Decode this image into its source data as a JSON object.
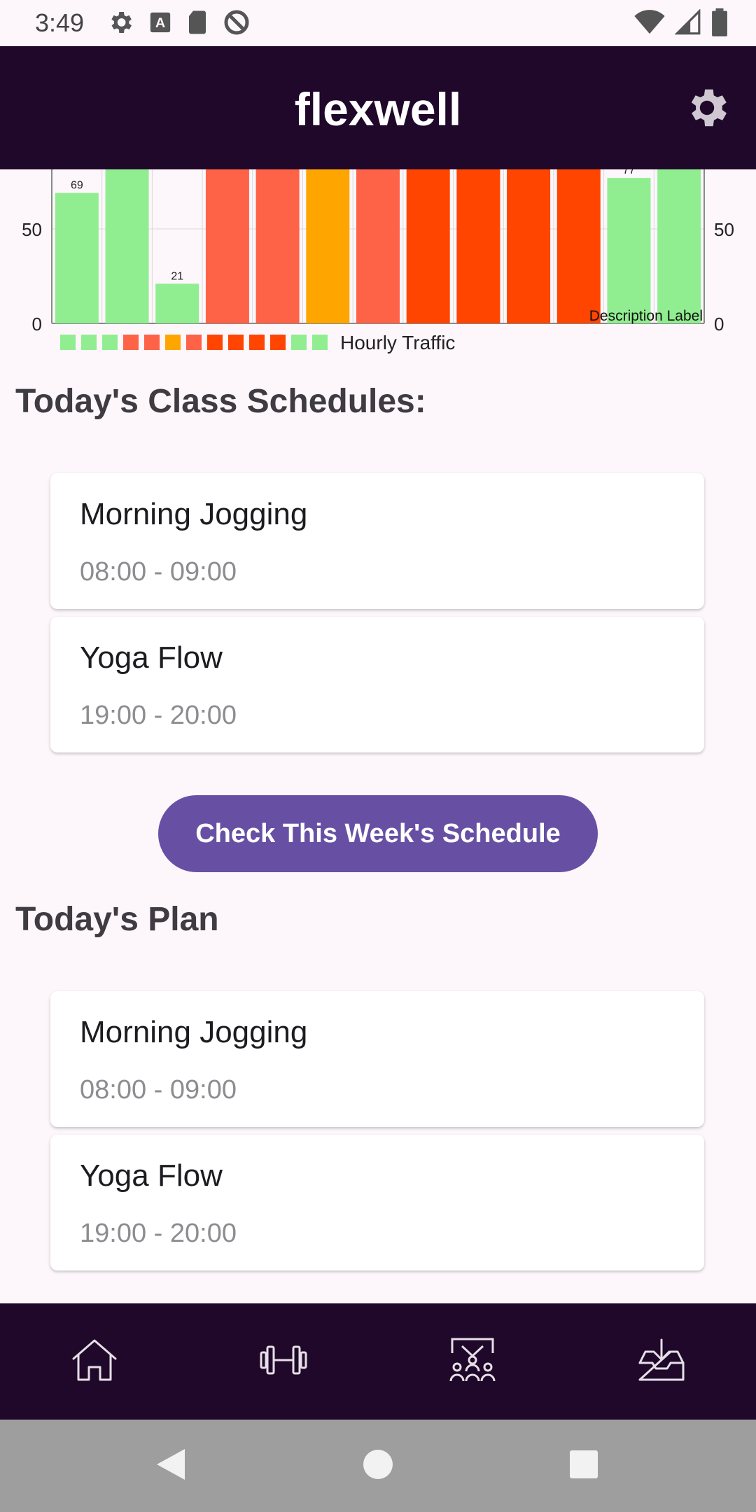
{
  "status_bar": {
    "time": "3:49",
    "left_icons": [
      "gear-icon",
      "text-a-icon",
      "sd-card-icon",
      "no-sync-icon"
    ],
    "right_icons": [
      "wifi-icon",
      "signal-icon",
      "battery-icon"
    ]
  },
  "app_bar": {
    "title": "flexwell",
    "settings_icon": "gear-icon"
  },
  "chart_data": {
    "type": "bar",
    "title": "",
    "xlabel": "",
    "ylabel": "",
    "ylim": [
      0,
      100
    ],
    "y_ticks": [
      0,
      50
    ],
    "values": [
      69,
      95,
      21,
      95,
      95,
      95,
      95,
      95,
      95,
      95,
      95,
      77,
      95
    ],
    "value_labels": [
      "69",
      "",
      "21",
      "",
      "",
      "",
      "",
      "",
      "",
      "",
      "",
      "77",
      ""
    ],
    "colors": [
      "#90ee90",
      "#90ee90",
      "#90ee90",
      "#ff6347",
      "#ff6347",
      "#ffa500",
      "#ff6347",
      "#ff4500",
      "#ff4500",
      "#ff4500",
      "#ff4500",
      "#90ee90",
      "#90ee90"
    ],
    "legend": {
      "label": "Hourly Traffic",
      "position": "bottom-left"
    },
    "description": "Description Label",
    "grid": true
  },
  "class_schedules": {
    "heading": "Today's Class Schedules:",
    "items": [
      {
        "title": "Morning Jogging",
        "time": "08:00 - 09:00"
      },
      {
        "title": "Yoga Flow",
        "time": "19:00 - 20:00"
      }
    ]
  },
  "schedule_button": {
    "label": "Check This Week's Schedule"
  },
  "plan": {
    "heading": "Today's Plan",
    "items": [
      {
        "title": "Morning Jogging",
        "time": "08:00 - 09:00"
      },
      {
        "title": "Yoga Flow",
        "time": "19:00 - 20:00"
      }
    ]
  },
  "bottom_nav": {
    "items": [
      {
        "icon": "home-icon"
      },
      {
        "icon": "dumbbell-icon"
      },
      {
        "icon": "group-class-icon"
      },
      {
        "icon": "inbox-download-icon"
      }
    ]
  },
  "colors": {
    "app_bar": "#20082a",
    "background": "#fdf7fb",
    "button": "#6750a4"
  }
}
